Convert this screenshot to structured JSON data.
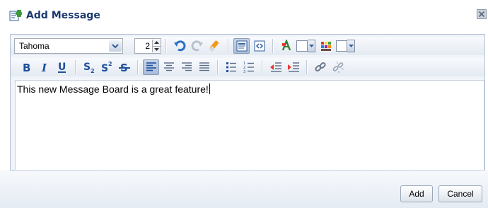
{
  "dialog": {
    "title": "Add Message",
    "icon": "add-message-icon",
    "close_icon": "close-icon"
  },
  "toolbar": {
    "font_family": "Tahoma",
    "font_size": "2",
    "row1_icons": [
      "undo-icon",
      "redo-icon",
      "clear-formatting-icon",
      "rich-text-mode-icon",
      "source-mode-icon",
      "text-color-icon",
      "background-color-icon"
    ],
    "row2_icons": [
      "bold-icon",
      "italic-icon",
      "underline-icon",
      "subscript-icon",
      "superscript-icon",
      "strikethrough-icon",
      "align-left-icon",
      "align-center-icon",
      "align-right-icon",
      "justify-icon",
      "bulleted-list-icon",
      "numbered-list-icon",
      "outdent-icon",
      "indent-icon",
      "link-icon",
      "unlink-icon"
    ],
    "text_color": "#ffffff",
    "background_color": "#ffffff"
  },
  "editor": {
    "content": "This new Message Board is a great feature!"
  },
  "buttons": {
    "add": "Add",
    "cancel": "Cancel"
  },
  "colors": {
    "title": "#1c3a6e",
    "toolbar_icon": "#1d4f9e",
    "frame_border": "#b5c3d6"
  }
}
